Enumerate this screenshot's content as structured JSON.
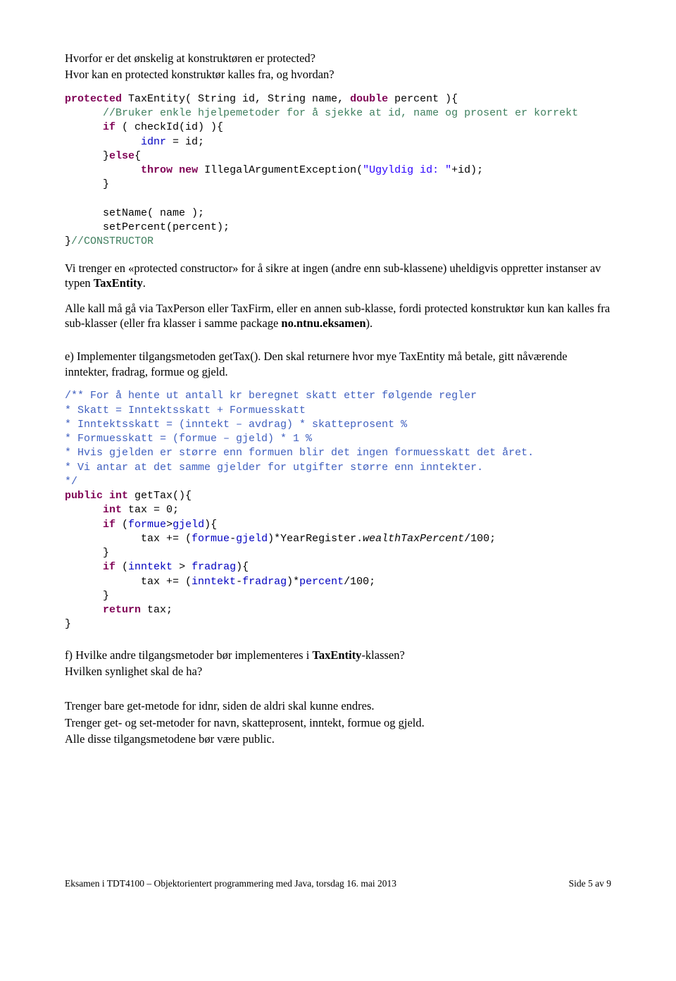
{
  "introA": "Hvorfor er det ønskelig at konstruktøren er protected?",
  "introB": "Hvor kan en protected konstruktør kalles fra, og hvordan?",
  "c1": {
    "kw_protected": "protected",
    "sig_open": " TaxEntity( String id, String name, ",
    "kw_double": "double",
    "sig_close": " percent ){",
    "cmt": "//Bruker enkle hjelpemetoder for å sjekke at id, name og prosent er korrekt",
    "kw_if": "if",
    "if_cond": " ( checkId(id) ){",
    "idnr_assign_a": "idnr",
    "idnr_assign_b": " = id;",
    "kw_else": "else",
    "else_open": "}",
    "else_brace": "{",
    "kw_throw": "throw",
    "kw_new": "new",
    "throw_tail": " IllegalArgumentException(",
    "str_ugyldig": "\"Ugyldig id: \"",
    "throw_end": "+id);",
    "close_brace": "}",
    "setName": "setName( name );",
    "setPercent": "setPercent(percent);",
    "ctor_end": "}",
    "ctor_cmt": "//CONSTRUCTOR"
  },
  "midA1": "Vi trenger en «protected constructor» for å sikre at ingen (andre enn sub-klassene) uheldigvis oppretter instanser av typen ",
  "midA_bold": "TaxEntity",
  "midA_tail": ".",
  "midB1": "Alle kall må gå via TaxPerson eller TaxFirm, eller en annen sub-klasse, fordi protected konstruktør kun kan kalles fra sub-klasser (eller fra klasser i samme package ",
  "midB_bold": "no.ntnu.eksamen",
  "midB_tail": ").",
  "sectE": "e) Implementer tilgangsmetoden getTax(). Den skal returnere hvor mye TaxEntity må betale, gitt nåværende inntekter, fradrag, formue og gjeld.",
  "c2": {
    "doc1": "/** For å hente ut antall kr beregnet skatt etter følgende regler",
    "doc2": "* Skatt = Inntektsskatt + Formuesskatt",
    "doc3": "* Inntektsskatt = (inntekt – avdrag) * skatteprosent %",
    "doc4": "* Formuesskatt = (formue – gjeld) * 1 %",
    "doc5": "* Hvis gjelden er større enn formuen blir det ingen formuesskatt det året.",
    "doc6": "* Vi antar at det samme gjelder for utgifter større enn inntekter.",
    "doc7": "*/",
    "kw_public": "public",
    "kw_int": "int",
    "sig": " getTax(){",
    "kw_int2": "int",
    "init": " tax = 0;",
    "kw_if": "if",
    "if1_open": " (",
    "f_formue": "formue",
    "gt1": ">",
    "f_gjeld": "gjeld",
    "if1_close": "){",
    "tax1_a": "tax += (",
    "tax1_b": "-",
    "tax1_c": ")*YearRegister.",
    "wtp": "wealthTaxPercent",
    "tax1_end": "/100;",
    "brace_close": "}",
    "if2_open": " (",
    "f_inntekt": "inntekt",
    "gt2": " > ",
    "f_fradrag": "fradrag",
    "if2_close": "){",
    "tax2_a": "tax += (",
    "tax2_b": "-",
    "tax2_c": ")*",
    "f_percent": "percent",
    "tax2_end": "/100;",
    "kw_return": "return",
    "ret_tail": " tax;",
    "outer_close": "}"
  },
  "sectF_a": "f) Hvilke andre tilgangsmetoder bør implementeres i ",
  "sectF_bold": "TaxEntity",
  "sectF_b": "-klassen?",
  "sectF_q2": "Hvilken synlighet skal de ha?",
  "ans1": "Trenger bare get-metode for idnr, siden de aldri skal kunne endres.",
  "ans2": "Trenger get- og set-metoder for navn, skatteprosent, inntekt, formue og gjeld.",
  "ans3": "Alle disse tilgangsmetodene bør være public.",
  "footer_left": "Eksamen i TDT4100 – Objektorientert programmering med Java, torsdag 16. mai 2013",
  "footer_right": "Side 5 av 9"
}
